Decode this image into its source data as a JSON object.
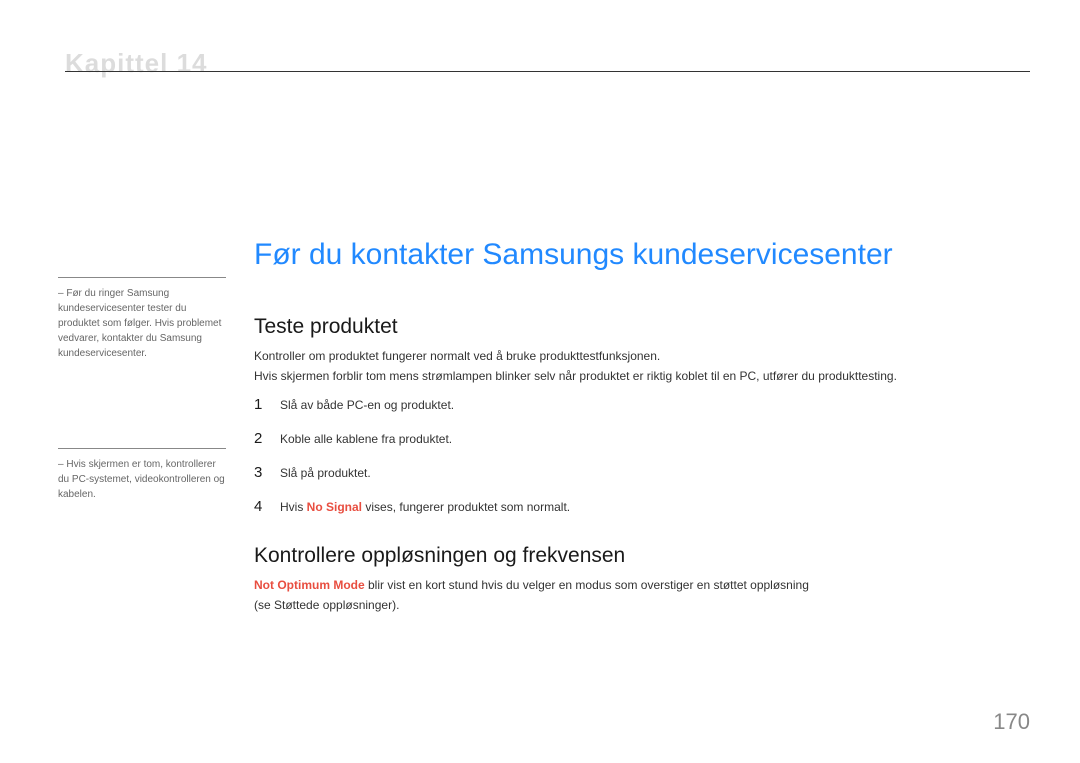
{
  "chapterLabel": "Kapittel 14",
  "mainTitle": "Før du kontakter Samsungs kundeservicesenter",
  "sidebar": {
    "note1": "Før du ringer Samsung kundeservicesenter tester du produktet som følger. Hvis problemet vedvarer, kontakter du Samsung kundeservicesenter.",
    "note2": "Hvis skjermen er tom, kontrollerer du PC-systemet, videokontrolleren og kabelen."
  },
  "sections": {
    "section1": {
      "title": "Teste produktet",
      "para1": "Kontroller om produktet fungerer normalt ved å bruke produkttestfunksjonen.",
      "para2": "Hvis skjermen forblir tom mens strømlampen blinker selv når produktet er riktig koblet til en PC, utfører du produkttesting.",
      "steps": {
        "s1num": "1",
        "s1text": "Slå av både PC-en og produktet.",
        "s2num": "2",
        "s2text": "Koble alle kablene fra produktet.",
        "s3num": "3",
        "s3text": "Slå på produktet.",
        "s4num": "4",
        "s4textPrefix": "Hvis ",
        "s4highlight": "No Signal",
        "s4textSuffix": " vises, fungerer produktet som normalt."
      }
    },
    "section2": {
      "title": "Kontrollere oppløsningen og frekvensen",
      "para3highlight": "Not Optimum Mode",
      "para3text": " blir vist en kort stund hvis du velger en modus som overstiger en støttet oppløsning",
      "para4": "(se Støttede oppløsninger)."
    }
  },
  "pageNumber": "170"
}
